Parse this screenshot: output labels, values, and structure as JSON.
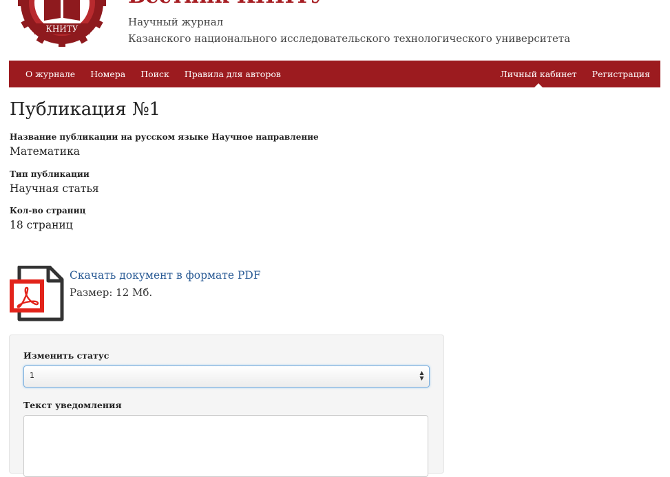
{
  "header": {
    "journal_title": "Вестник КНИТУ",
    "subtitle_line1": "Научный журнал",
    "subtitle_line2": "Казанского национального исследовательского технологического университета",
    "logo_text": "КНИТУ"
  },
  "nav": {
    "left_items": [
      "О журнале",
      "Номера",
      "Поиск",
      "Правила для авторов"
    ],
    "right_items": [
      "Личный кабинет",
      "Регистрация"
    ],
    "active_item": "Личный кабинет"
  },
  "publication": {
    "title": "Публикация №1",
    "fields": [
      {
        "label": "Название публикации на русском языке Научное направление",
        "value": "Математика"
      },
      {
        "label": "Тип публикации",
        "value": "Научная статья"
      },
      {
        "label": "Кол-во страниц",
        "value": "18 страниц"
      }
    ]
  },
  "download": {
    "link_text": "Скачать документ в формате PDF",
    "size_text": "Размер: 12 Мб."
  },
  "status_form": {
    "status_label": "Изменить статус",
    "status_value": "1",
    "notification_label": "Текст уведомления",
    "notification_value": ""
  },
  "colors": {
    "brand": "#9c1b1f",
    "link": "#2a5b95",
    "pdf_red": "#e2231a"
  }
}
